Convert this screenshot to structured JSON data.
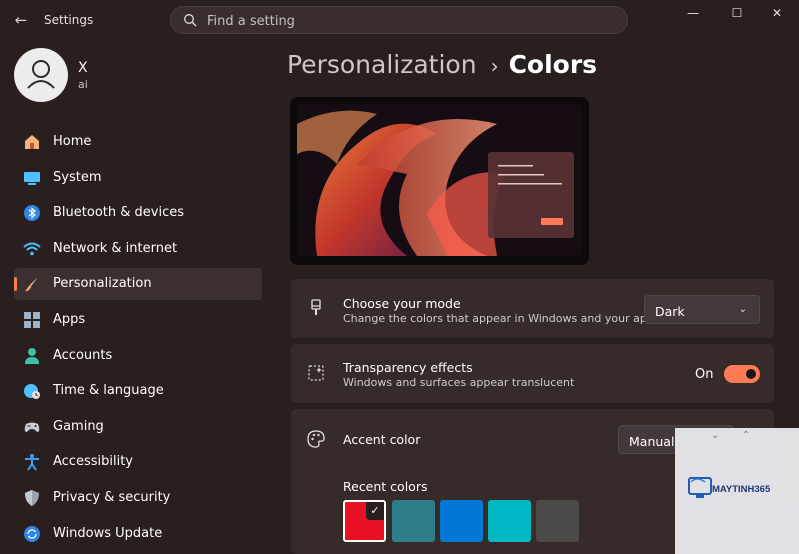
{
  "window": {
    "title": "Settings",
    "minimize_glyph": "—",
    "maximize_glyph": "☐",
    "close_glyph": "✕",
    "back_glyph": "←"
  },
  "search": {
    "placeholder": "Find a setting"
  },
  "profile": {
    "name": "X",
    "email": "ai"
  },
  "sidebar": {
    "items": [
      {
        "label": "Home",
        "icon": "home-icon"
      },
      {
        "label": "System",
        "icon": "monitor-icon"
      },
      {
        "label": "Bluetooth & devices",
        "icon": "bluetooth-icon"
      },
      {
        "label": "Network & internet",
        "icon": "wifi-icon"
      },
      {
        "label": "Personalization",
        "icon": "brush-icon",
        "active": true
      },
      {
        "label": "Apps",
        "icon": "apps-icon"
      },
      {
        "label": "Accounts",
        "icon": "person-icon"
      },
      {
        "label": "Time & language",
        "icon": "globe-clock-icon"
      },
      {
        "label": "Gaming",
        "icon": "gamepad-icon"
      },
      {
        "label": "Accessibility",
        "icon": "accessibility-icon"
      },
      {
        "label": "Privacy & security",
        "icon": "shield-icon"
      },
      {
        "label": "Windows Update",
        "icon": "update-icon"
      }
    ]
  },
  "breadcrumb": {
    "parent": "Personalization",
    "separator": "›",
    "current": "Colors"
  },
  "mode": {
    "title": "Choose your mode",
    "subtitle": "Change the colors that appear in Windows and your apps",
    "value": "Dark"
  },
  "transparency": {
    "title": "Transparency effects",
    "subtitle": "Windows and surfaces appear translucent",
    "state_label": "On",
    "enabled": true
  },
  "accent": {
    "title": "Accent color",
    "value": "Manual",
    "recent_title": "Recent colors",
    "recent_colors": [
      "#e81123",
      "#2d7d8a",
      "#0078d4",
      "#00b7c3",
      "#4c4a48"
    ],
    "check_glyph": "✓"
  },
  "watermark": {
    "text": "MAYTINH365"
  },
  "colors": {
    "accent": "#ff7a57",
    "background": "#2a1f1f",
    "card": "#372b2a"
  }
}
